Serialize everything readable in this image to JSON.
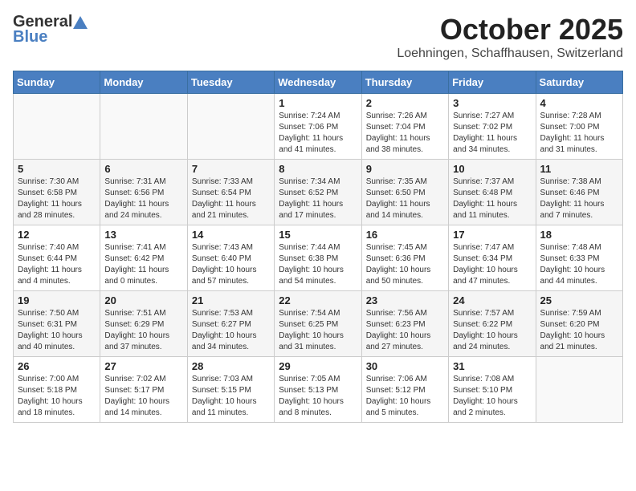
{
  "header": {
    "logo_general": "General",
    "logo_blue": "Blue",
    "month": "October 2025",
    "location": "Loehningen, Schaffhausen, Switzerland"
  },
  "days_of_week": [
    "Sunday",
    "Monday",
    "Tuesday",
    "Wednesday",
    "Thursday",
    "Friday",
    "Saturday"
  ],
  "weeks": [
    [
      {
        "day": "",
        "info": ""
      },
      {
        "day": "",
        "info": ""
      },
      {
        "day": "",
        "info": ""
      },
      {
        "day": "1",
        "info": "Sunrise: 7:24 AM\nSunset: 7:06 PM\nDaylight: 11 hours\nand 41 minutes."
      },
      {
        "day": "2",
        "info": "Sunrise: 7:26 AM\nSunset: 7:04 PM\nDaylight: 11 hours\nand 38 minutes."
      },
      {
        "day": "3",
        "info": "Sunrise: 7:27 AM\nSunset: 7:02 PM\nDaylight: 11 hours\nand 34 minutes."
      },
      {
        "day": "4",
        "info": "Sunrise: 7:28 AM\nSunset: 7:00 PM\nDaylight: 11 hours\nand 31 minutes."
      }
    ],
    [
      {
        "day": "5",
        "info": "Sunrise: 7:30 AM\nSunset: 6:58 PM\nDaylight: 11 hours\nand 28 minutes."
      },
      {
        "day": "6",
        "info": "Sunrise: 7:31 AM\nSunset: 6:56 PM\nDaylight: 11 hours\nand 24 minutes."
      },
      {
        "day": "7",
        "info": "Sunrise: 7:33 AM\nSunset: 6:54 PM\nDaylight: 11 hours\nand 21 minutes."
      },
      {
        "day": "8",
        "info": "Sunrise: 7:34 AM\nSunset: 6:52 PM\nDaylight: 11 hours\nand 17 minutes."
      },
      {
        "day": "9",
        "info": "Sunrise: 7:35 AM\nSunset: 6:50 PM\nDaylight: 11 hours\nand 14 minutes."
      },
      {
        "day": "10",
        "info": "Sunrise: 7:37 AM\nSunset: 6:48 PM\nDaylight: 11 hours\nand 11 minutes."
      },
      {
        "day": "11",
        "info": "Sunrise: 7:38 AM\nSunset: 6:46 PM\nDaylight: 11 hours\nand 7 minutes."
      }
    ],
    [
      {
        "day": "12",
        "info": "Sunrise: 7:40 AM\nSunset: 6:44 PM\nDaylight: 11 hours\nand 4 minutes."
      },
      {
        "day": "13",
        "info": "Sunrise: 7:41 AM\nSunset: 6:42 PM\nDaylight: 11 hours\nand 0 minutes."
      },
      {
        "day": "14",
        "info": "Sunrise: 7:43 AM\nSunset: 6:40 PM\nDaylight: 10 hours\nand 57 minutes."
      },
      {
        "day": "15",
        "info": "Sunrise: 7:44 AM\nSunset: 6:38 PM\nDaylight: 10 hours\nand 54 minutes."
      },
      {
        "day": "16",
        "info": "Sunrise: 7:45 AM\nSunset: 6:36 PM\nDaylight: 10 hours\nand 50 minutes."
      },
      {
        "day": "17",
        "info": "Sunrise: 7:47 AM\nSunset: 6:34 PM\nDaylight: 10 hours\nand 47 minutes."
      },
      {
        "day": "18",
        "info": "Sunrise: 7:48 AM\nSunset: 6:33 PM\nDaylight: 10 hours\nand 44 minutes."
      }
    ],
    [
      {
        "day": "19",
        "info": "Sunrise: 7:50 AM\nSunset: 6:31 PM\nDaylight: 10 hours\nand 40 minutes."
      },
      {
        "day": "20",
        "info": "Sunrise: 7:51 AM\nSunset: 6:29 PM\nDaylight: 10 hours\nand 37 minutes."
      },
      {
        "day": "21",
        "info": "Sunrise: 7:53 AM\nSunset: 6:27 PM\nDaylight: 10 hours\nand 34 minutes."
      },
      {
        "day": "22",
        "info": "Sunrise: 7:54 AM\nSunset: 6:25 PM\nDaylight: 10 hours\nand 31 minutes."
      },
      {
        "day": "23",
        "info": "Sunrise: 7:56 AM\nSunset: 6:23 PM\nDaylight: 10 hours\nand 27 minutes."
      },
      {
        "day": "24",
        "info": "Sunrise: 7:57 AM\nSunset: 6:22 PM\nDaylight: 10 hours\nand 24 minutes."
      },
      {
        "day": "25",
        "info": "Sunrise: 7:59 AM\nSunset: 6:20 PM\nDaylight: 10 hours\nand 21 minutes."
      }
    ],
    [
      {
        "day": "26",
        "info": "Sunrise: 7:00 AM\nSunset: 5:18 PM\nDaylight: 10 hours\nand 18 minutes."
      },
      {
        "day": "27",
        "info": "Sunrise: 7:02 AM\nSunset: 5:17 PM\nDaylight: 10 hours\nand 14 minutes."
      },
      {
        "day": "28",
        "info": "Sunrise: 7:03 AM\nSunset: 5:15 PM\nDaylight: 10 hours\nand 11 minutes."
      },
      {
        "day": "29",
        "info": "Sunrise: 7:05 AM\nSunset: 5:13 PM\nDaylight: 10 hours\nand 8 minutes."
      },
      {
        "day": "30",
        "info": "Sunrise: 7:06 AM\nSunset: 5:12 PM\nDaylight: 10 hours\nand 5 minutes."
      },
      {
        "day": "31",
        "info": "Sunrise: 7:08 AM\nSunset: 5:10 PM\nDaylight: 10 hours\nand 2 minutes."
      },
      {
        "day": "",
        "info": ""
      }
    ]
  ]
}
